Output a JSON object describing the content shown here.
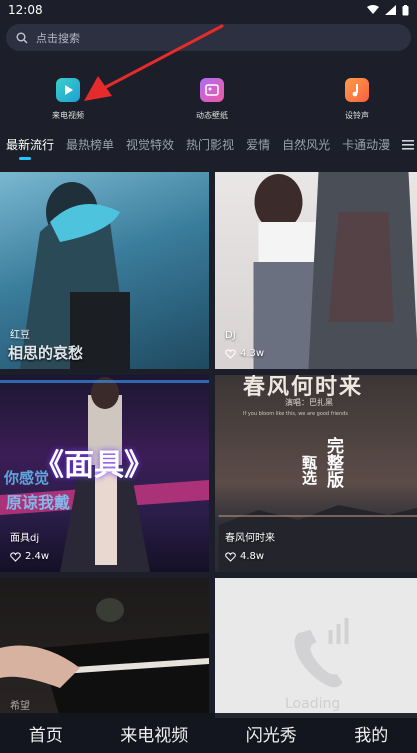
{
  "status": {
    "time": "12:08"
  },
  "search": {
    "placeholder": "点击搜索"
  },
  "shortcuts": [
    {
      "label": "来电视频",
      "icon": "play-icon"
    },
    {
      "label": "动态壁纸",
      "icon": "wallpaper-icon"
    },
    {
      "label": "设铃声",
      "icon": "ringtone-icon"
    }
  ],
  "tabs": [
    "最新流行",
    "最热榜单",
    "视觉特效",
    "热门影视",
    "爱情",
    "自然风光",
    "卡通动漫"
  ],
  "tab_menu_icon": "menu-icon",
  "cards": [
    {
      "title": "红豆",
      "likes": ""
    },
    {
      "title": "DJ",
      "likes": "4.3w"
    },
    {
      "title": "面具dj",
      "likes": "2.4w"
    },
    {
      "title": "春风何时来",
      "likes": "4.8w"
    },
    {
      "title": "希望",
      "likes": ""
    },
    {
      "title": "",
      "likes": ""
    }
  ],
  "card_overlay_text": {
    "card1": "相思的哀愁",
    "card3_main": "《面具》",
    "card3_sub": "原谅我戴",
    "card3_top": "你感觉",
    "card4_banner": "春风何时来",
    "card4_singer": "演唱：巴扎黑",
    "card4_lyric": "If you bloom like this, we are good friends",
    "card4_tag_a": "甄选",
    "card4_tag_b": "完整版",
    "card6_loading": "Loading"
  },
  "bottom_nav": [
    "首页",
    "来电视频",
    "闪光秀",
    "我的"
  ],
  "colors": {
    "accent": "#24c7ff",
    "background": "#1c1f29"
  }
}
